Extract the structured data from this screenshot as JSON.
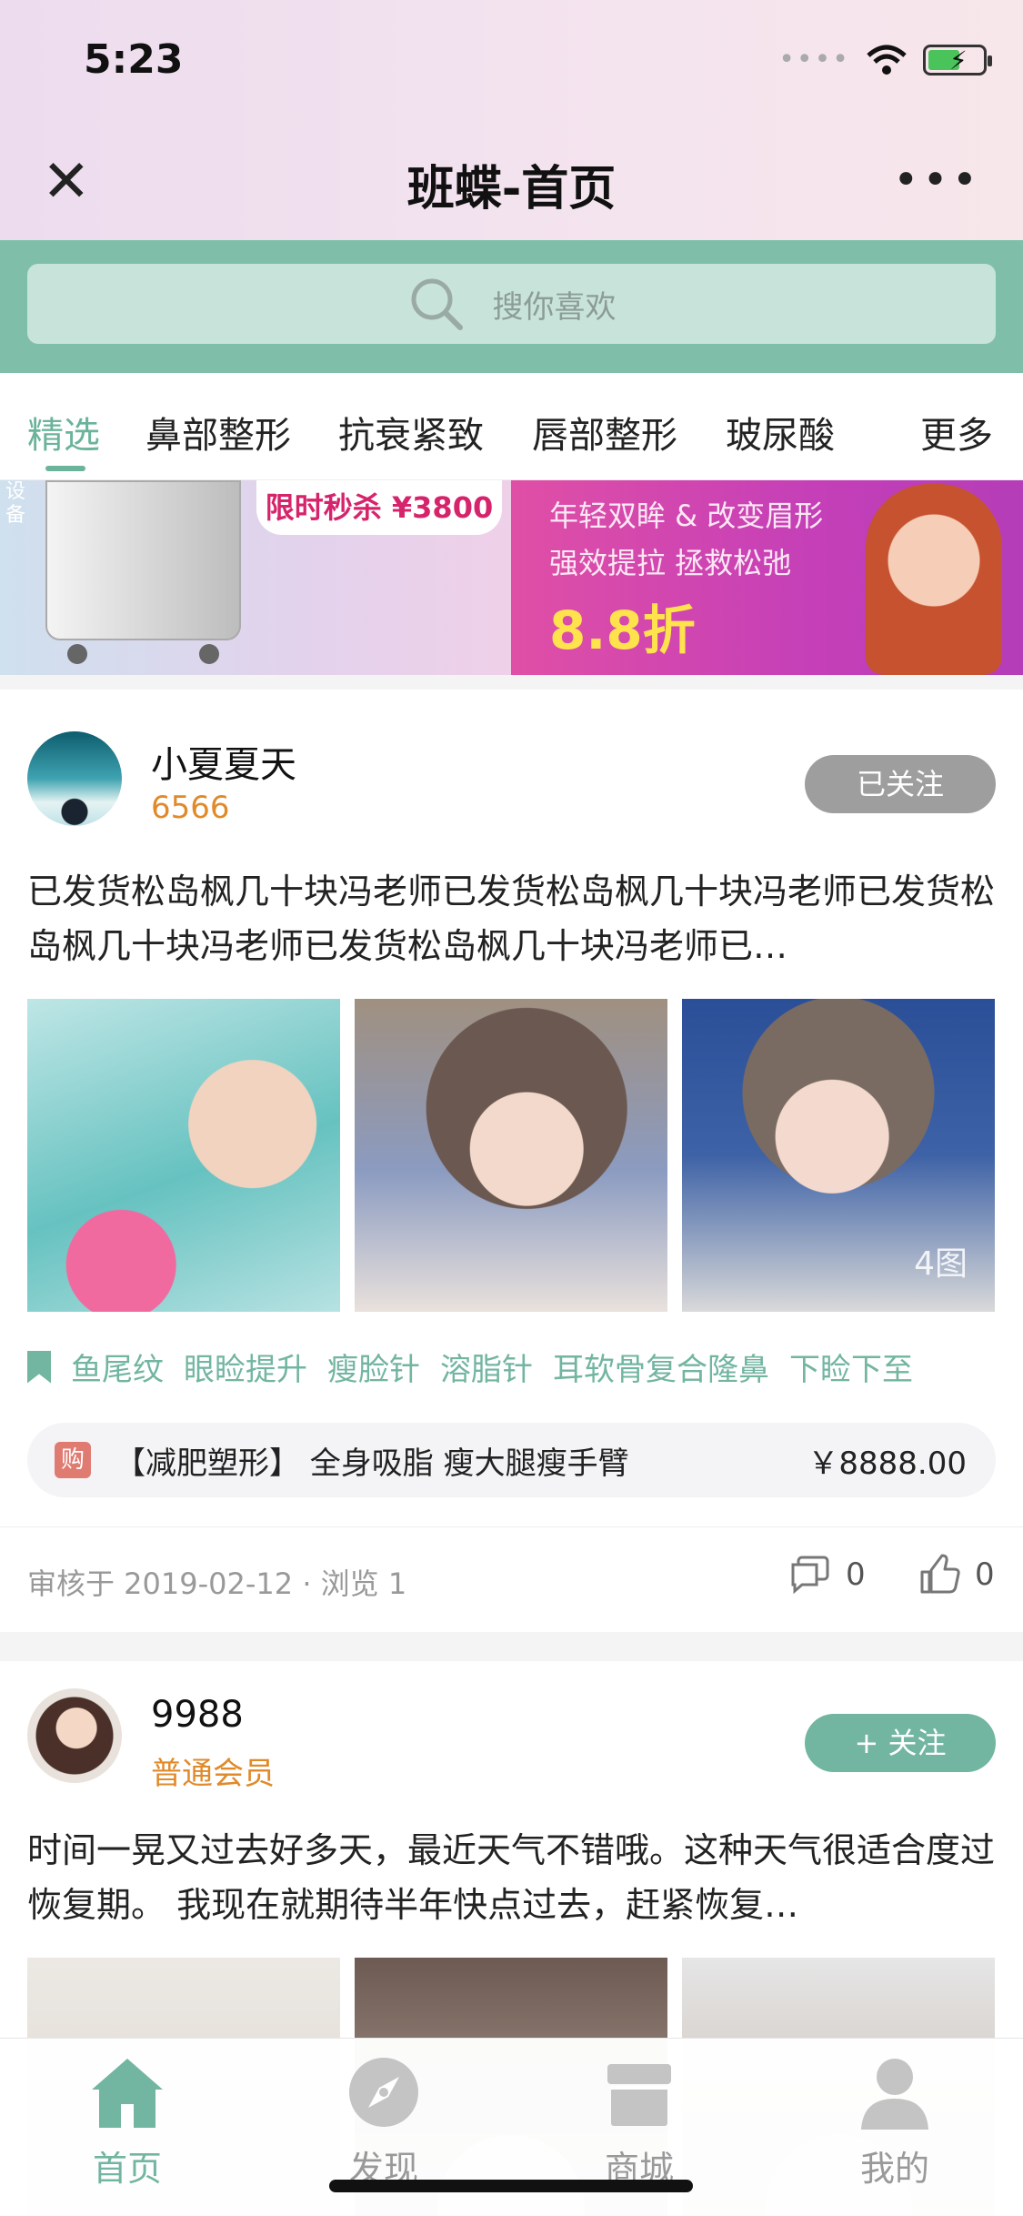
{
  "status": {
    "time": "5:23"
  },
  "nav": {
    "title": "班蝶-首页"
  },
  "search": {
    "placeholder": "搜你喜欢"
  },
  "tabs": [
    {
      "label": "精选",
      "active": true
    },
    {
      "label": "鼻部整形"
    },
    {
      "label": "抗衰紧致"
    },
    {
      "label": "唇部整形"
    },
    {
      "label": "玻尿酸"
    },
    {
      "label": "更多"
    }
  ],
  "banner": {
    "left_side_text": "设备",
    "flash_sale": "限时秒杀 ¥3800",
    "right_line1": "年轻双眸 & 改变眉形",
    "right_line2": "强效提拉 拯救松弛",
    "right_discount": "8.8折"
  },
  "posts": [
    {
      "username": "小夏夏天",
      "subline": "6566",
      "follow_label": "已关注",
      "text": "已发货松岛枫几十块冯老师已发货松岛枫几十块冯老师已发货松岛枫几十块冯老师已发货松岛枫几十块冯老师已…",
      "photo_count": "4图",
      "tags": [
        "鱼尾纹",
        "眼睑提升",
        "瘦脸针",
        "溶脂针",
        "耳软骨复合隆鼻",
        "下睑下至"
      ],
      "product": {
        "badge": "购",
        "name": "【减肥塑形】 全身吸脂 瘦大腿瘦手臂",
        "price": "￥8888.00"
      },
      "meta": "审核于 2019-02-12 · 浏览 1",
      "comments": "0",
      "likes": "0"
    },
    {
      "username": "9988",
      "subline": "普通会员",
      "follow_label": "+ 关注",
      "text": "时间一晃又过去好多天，最近天气不错哦。这种天气很适合度过恢复期。 我现在就期待半年快点过去，赶紧恢复…"
    }
  ],
  "tabbar": [
    {
      "label": "首页",
      "icon": "home-icon",
      "active": true
    },
    {
      "label": "发现",
      "icon": "discover-icon"
    },
    {
      "label": "商城",
      "icon": "store-icon"
    },
    {
      "label": "我的",
      "icon": "profile-icon"
    }
  ],
  "colors": {
    "accent": "#72b5a0",
    "header_bg": "#7fbfaa",
    "orange": "#e08a2a"
  }
}
